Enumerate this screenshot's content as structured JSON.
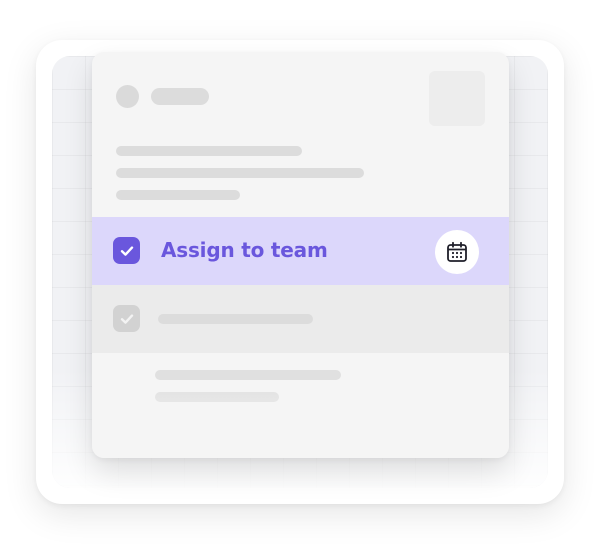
{
  "task": {
    "title": "Assign to team",
    "completed": true
  },
  "secondary_task": {
    "completed": true
  },
  "icons": {
    "primary_checkbox": "check-icon",
    "secondary_checkbox": "check-icon",
    "date_button": "calendar-icon"
  },
  "colors": {
    "accent": "#6a57dd",
    "highlight_row": "#dcd7fb",
    "card_background": "#f5f5f5",
    "placeholder": "#dcdcdc"
  }
}
